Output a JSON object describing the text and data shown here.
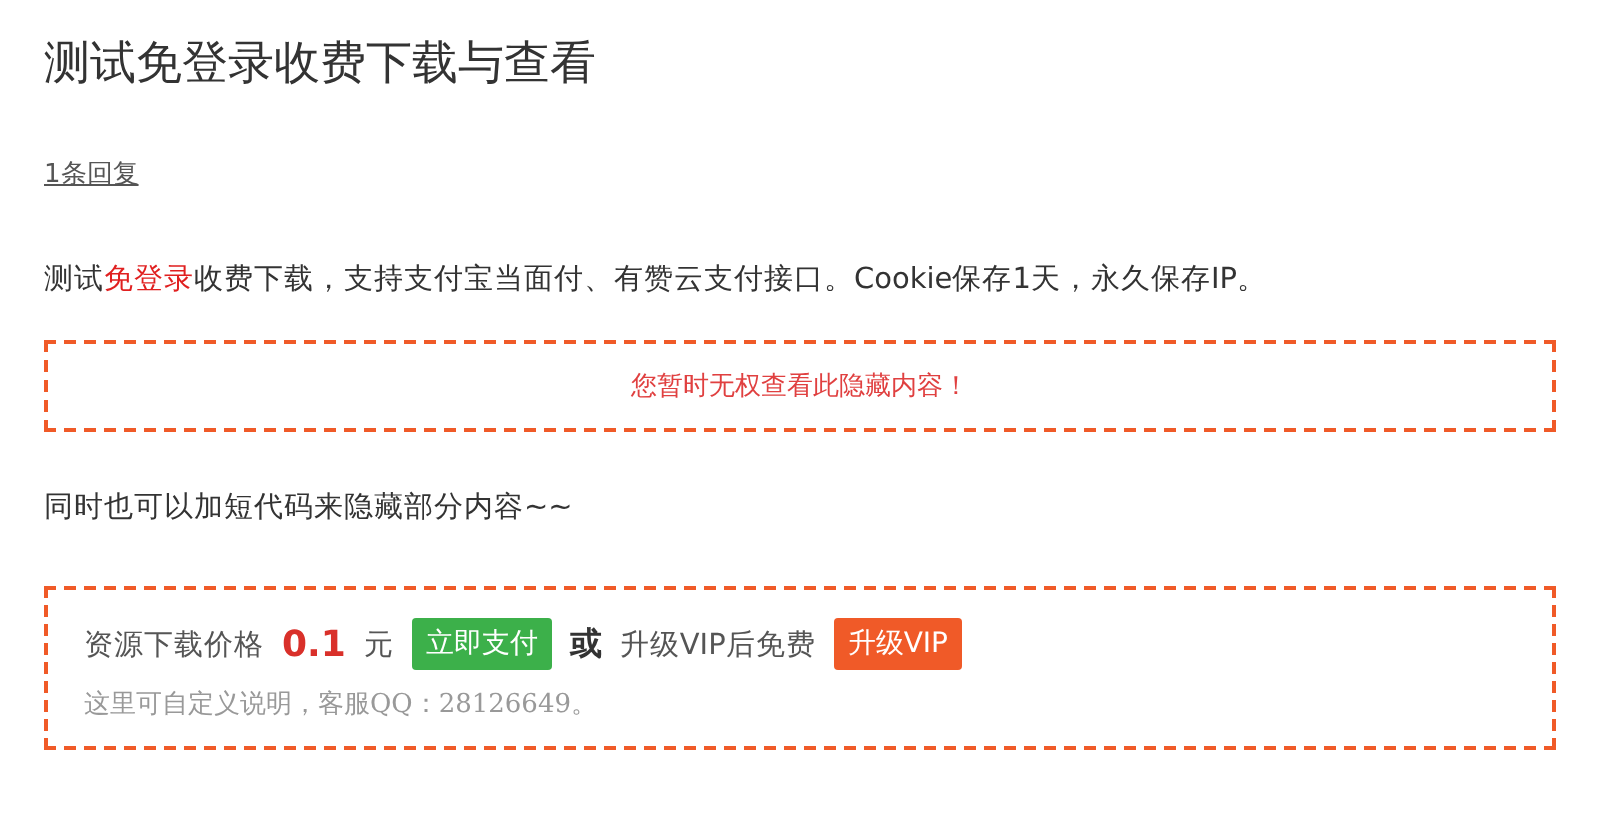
{
  "title": "测试免登录收费下载与查看",
  "reply_link": "1条回复",
  "intro": [
    {
      "text": "测试",
      "highlight": false
    },
    {
      "text": "免登录",
      "highlight": true
    },
    {
      "text": "收费下载，支持支付宝当面付、有赞云支付接口。Cookie保存1天，永久保存IP。",
      "highlight": false
    }
  ],
  "hidden_notice": "您暂时无权查看此隐藏内容！",
  "note": "同时也可以加短代码来隐藏部分内容~~",
  "pay_box": {
    "price_label": "资源下载价格",
    "price": "0.1",
    "unit": "元",
    "pay_button": "立即支付",
    "or": "或",
    "vip_text": "升级VIP后免费",
    "vip_button": "升级VIP",
    "description": "这里可自定义说明，客服QQ：28126649。"
  }
}
